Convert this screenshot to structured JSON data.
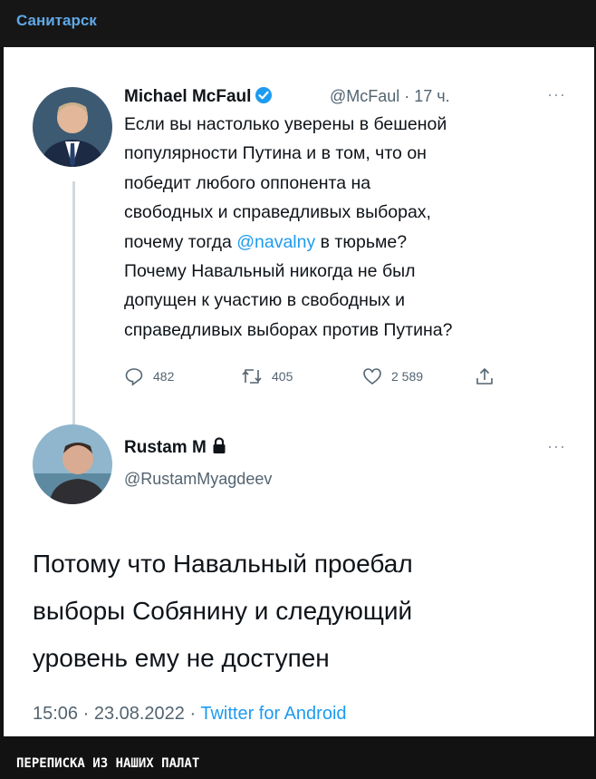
{
  "channel": {
    "name": "Санитарск"
  },
  "tweet": {
    "author_name": "Michael McFaul",
    "handle_time": "@McFaul · 17 ч.",
    "text_before": "Если вы настолько уверены в бешеной\nпопулярности Путина и в том, что он\nпобедит любого оппонента на\nсвободных и справедливых выборах,\nпочему тогда ",
    "mention": "@navalny",
    "text_after": " в тюрьме?\nПочему Навальный никогда не был\nдопущен к участию в свободных и\nсправедливых выборах против Путина?",
    "more": "···",
    "actions": {
      "replies": "482",
      "retweets": "405",
      "likes": "2 589"
    },
    "icons": [
      "verified-badge-icon",
      "reply-icon",
      "retweet-icon",
      "like-icon",
      "share-icon",
      "more-icon"
    ]
  },
  "reply": {
    "author_name": "Rustam M",
    "handle": "@RustamMyagdeev",
    "more": "···",
    "text": "Потому что Навальный проебал\nвыборы Собянину и следующий\nуровень ему не доступен",
    "timestamp": "15:06 · 23.08.2022 · ",
    "source": "Twitter for Android",
    "icons": [
      "lock-icon"
    ]
  },
  "caption": "ПЕРЕПИСКА ИЗ НАШИХ ПАЛАТ",
  "colors": {
    "link": "#1d9bf0",
    "channel_name": "#5fa8e6",
    "background": "#121212"
  }
}
